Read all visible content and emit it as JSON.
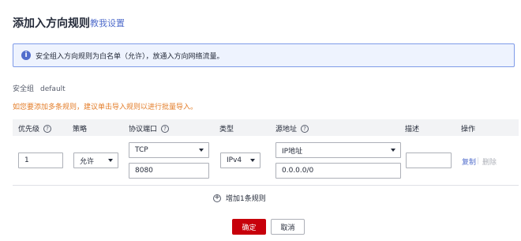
{
  "header": {
    "title": "添加入方向规则",
    "help_link": "教我设置"
  },
  "notice": {
    "icon": "info-icon",
    "text": "安全组入方向规则为白名单（允许），放通入方向网络流量。"
  },
  "security_group": {
    "label": "安全组",
    "value": "default"
  },
  "tip": "如您要添加多条规则，建议单击导入规则以进行批量导入。",
  "table": {
    "headers": {
      "priority": "优先级",
      "policy": "策略",
      "protocol_port": "协议端口",
      "type": "类型",
      "source": "源地址",
      "description": "描述",
      "operation": "操作"
    },
    "rows": [
      {
        "priority": "1",
        "policy": "允许",
        "protocol": "TCP",
        "port": "8080",
        "type": "IPv4",
        "source_type": "IP地址",
        "source_value": "0.0.0.0/0",
        "description": "",
        "action_copy": "复制",
        "action_delete": "删除"
      }
    ]
  },
  "add_rule": "增加1条规则",
  "footer": {
    "confirm": "确定",
    "cancel": "取消"
  },
  "colors": {
    "primary": "#c7000b",
    "link": "#526ecc",
    "warning": "#e37d29",
    "notice_bg": "#eef3fe"
  }
}
